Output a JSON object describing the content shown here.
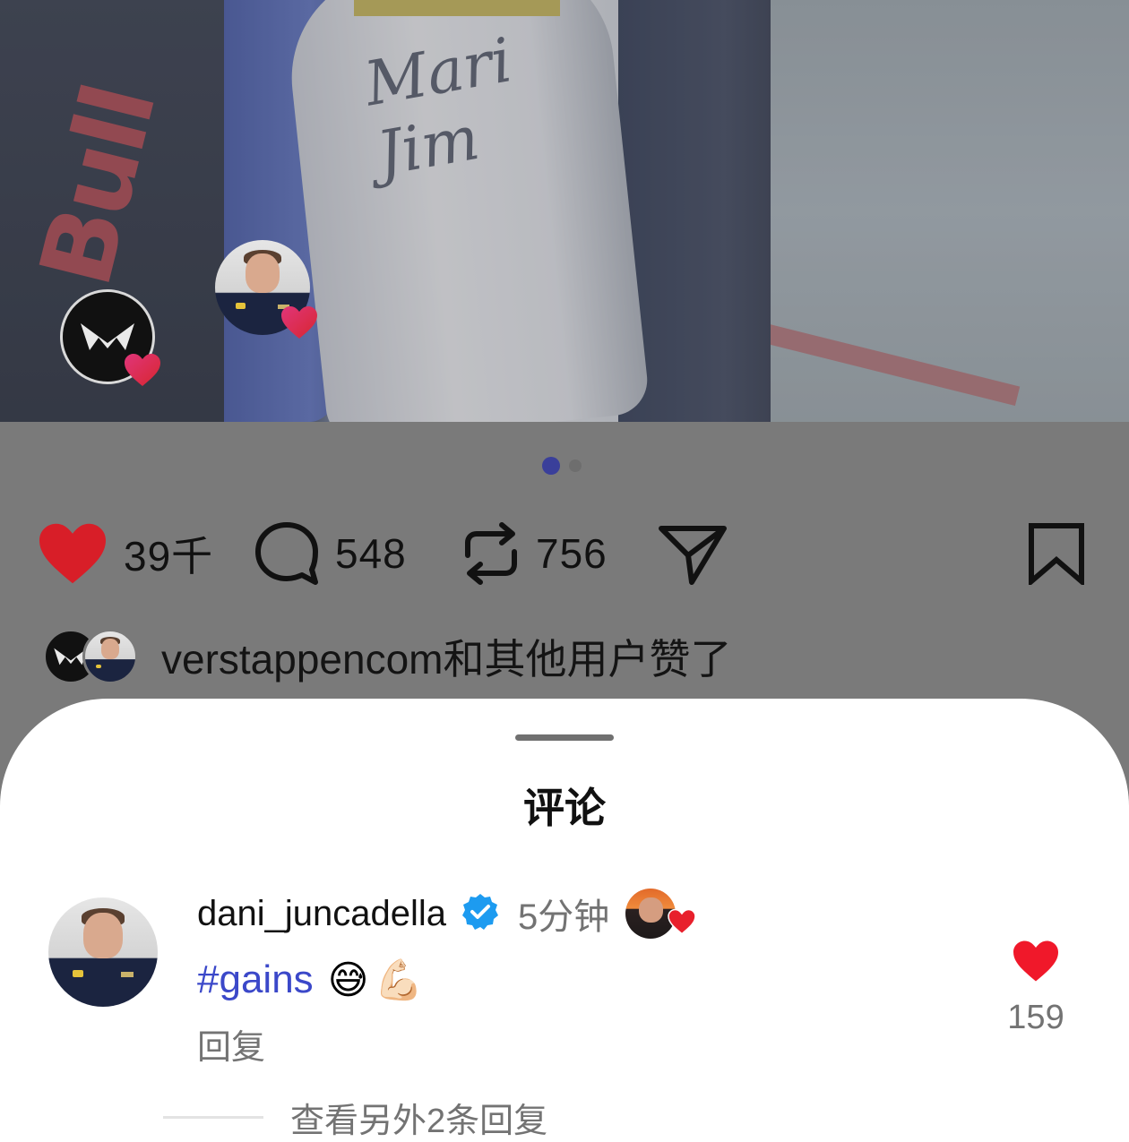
{
  "post": {
    "likes": "39千",
    "comments": "548",
    "reposts": "756",
    "liked_by_text": "verstappencom和其他用户赞了",
    "carousel": {
      "total": 2,
      "active": 1
    },
    "photo_texts": {
      "sleeve_logo": "Bull",
      "signature": "Mari Jim"
    }
  },
  "sheet": {
    "title": "评论"
  },
  "comment": {
    "username": "dani_juncadella",
    "time": "5分钟",
    "hashtag": "#gains",
    "emoji_1": "😅",
    "emoji_2": "💪🏻",
    "reply_label": "回复",
    "like_count": "159",
    "more_replies": "查看另外2条回复"
  },
  "colors": {
    "heart_red": "#e0202a",
    "hashtag_blue": "#3b48c9",
    "verified_blue": "#1d9bf0",
    "dot_active": "#3a3f9a"
  },
  "icons": [
    "heart-icon",
    "comment-icon",
    "repost-icon",
    "share-icon",
    "bookmark-icon",
    "verified-icon"
  ]
}
